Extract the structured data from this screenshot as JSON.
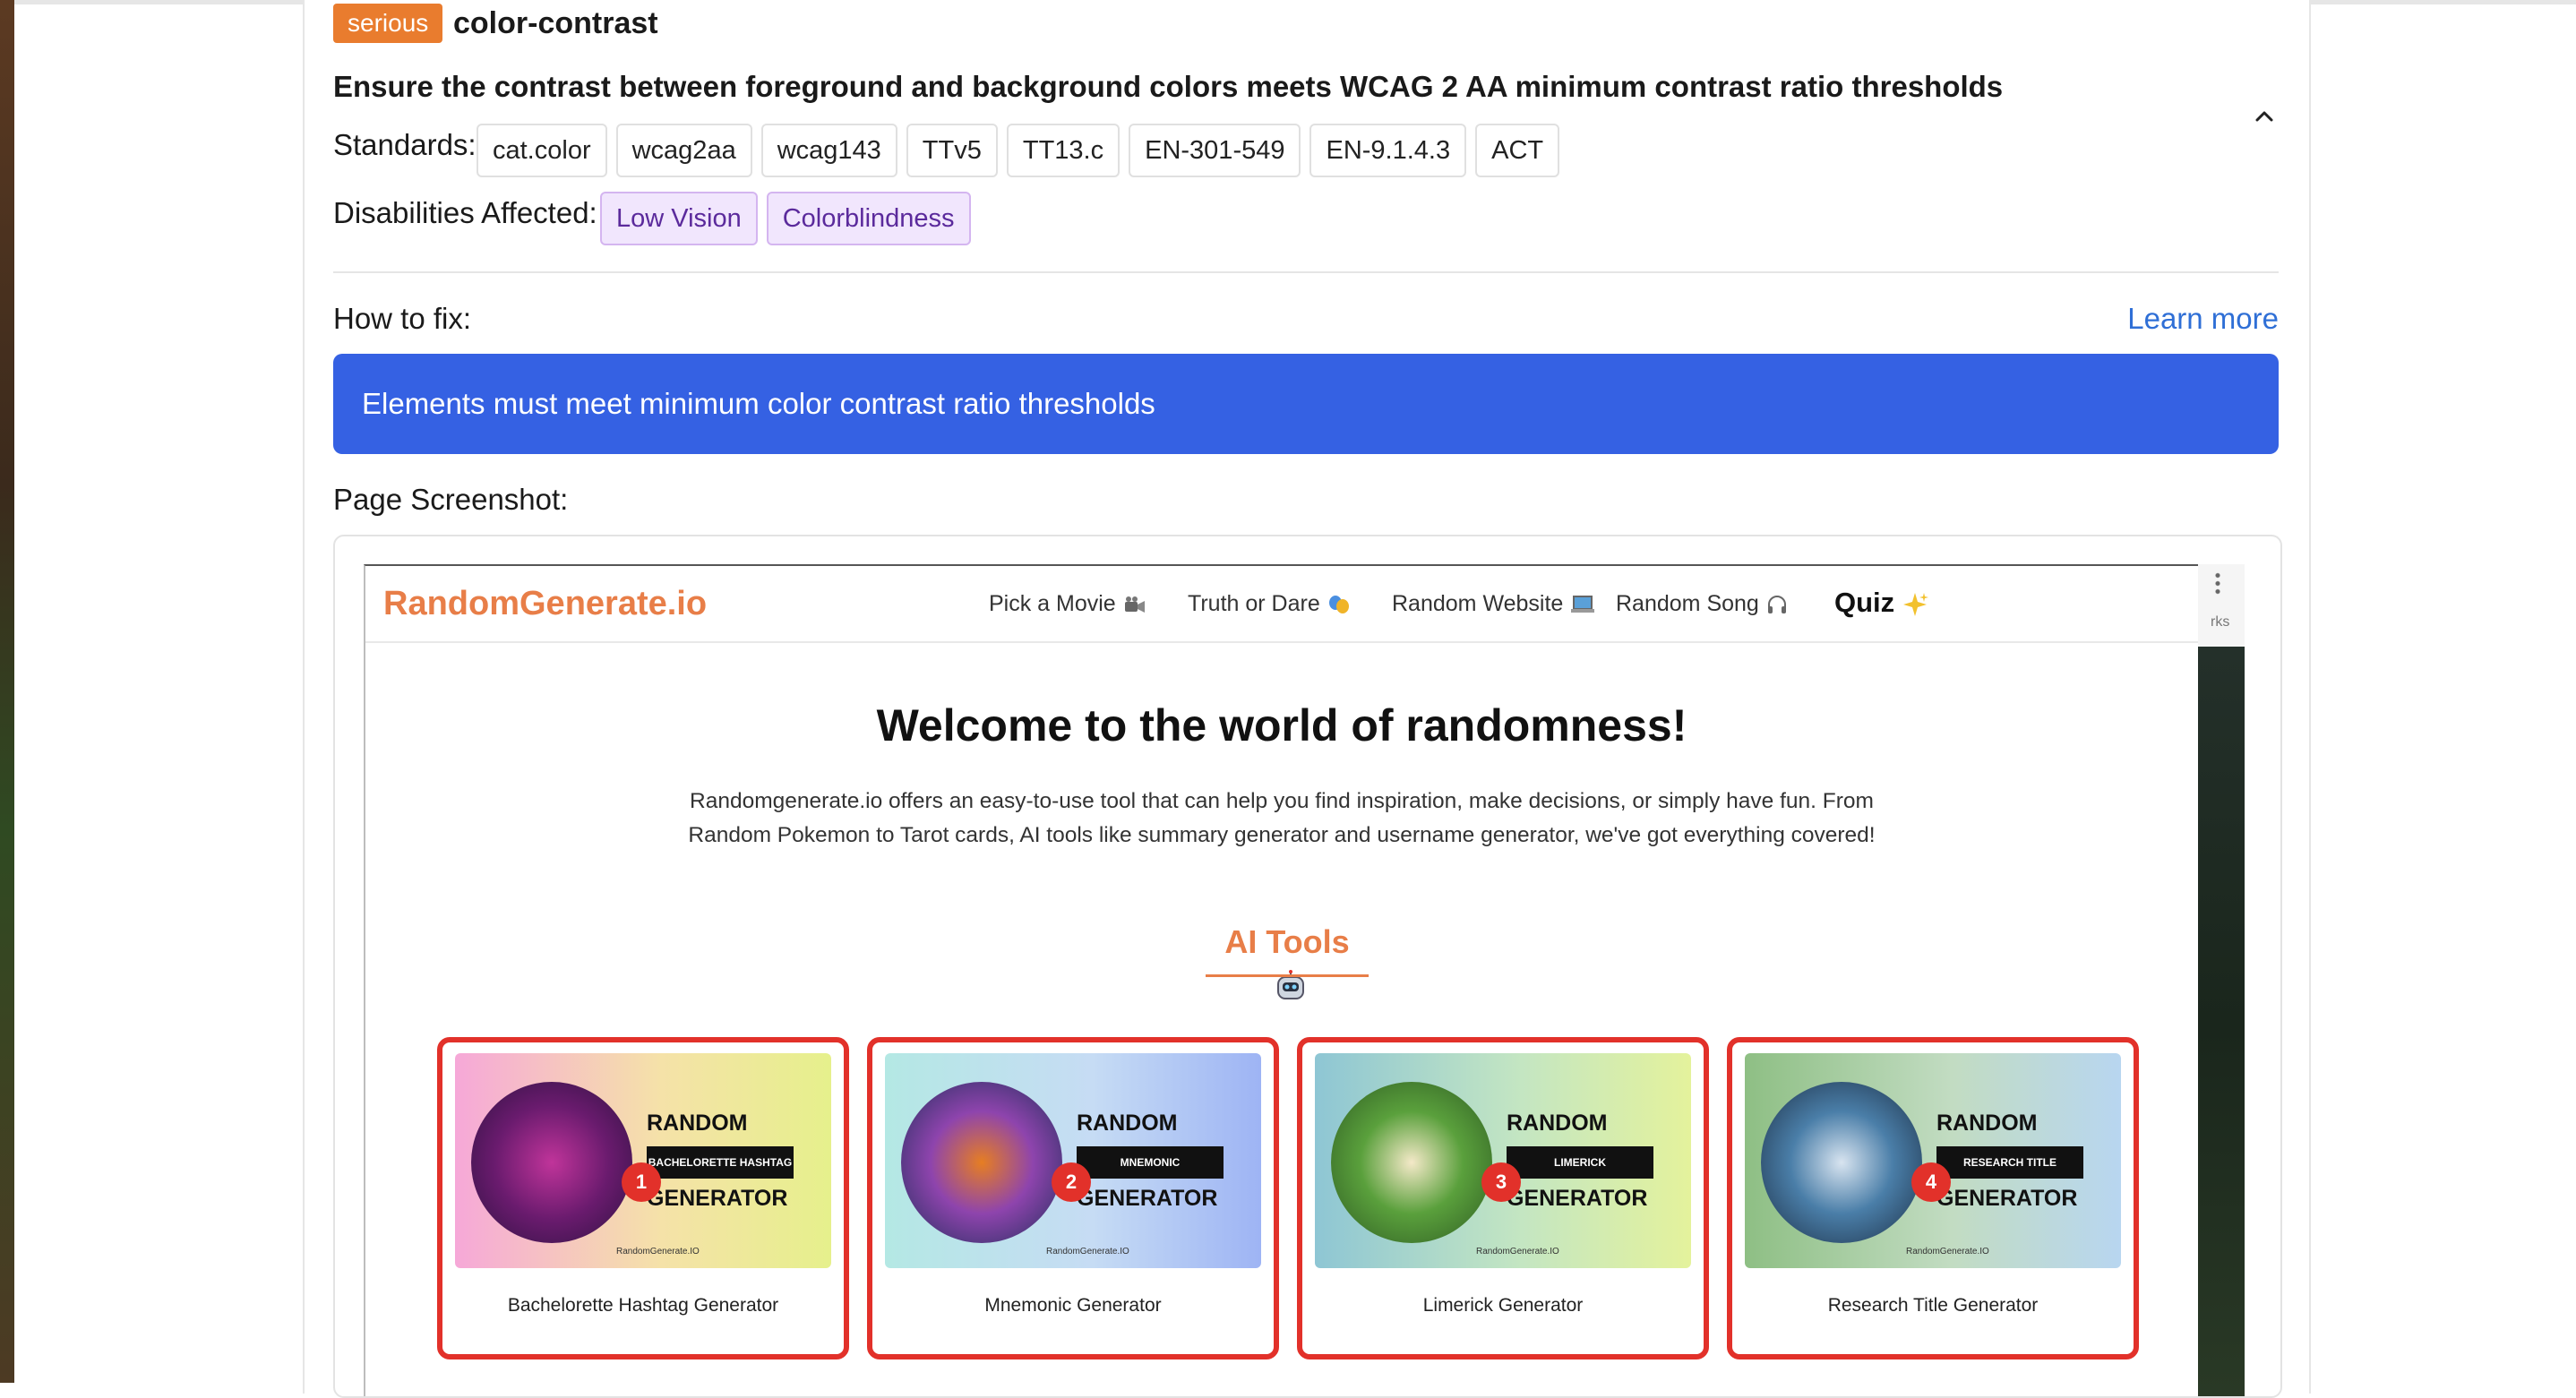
{
  "issue": {
    "impact": "serious",
    "rule_id": "color-contrast",
    "description": "Ensure the contrast between foreground and background colors meets WCAG 2 AA minimum contrast ratio thresholds",
    "standards_label": "Standards:",
    "standards": [
      "cat.color",
      "wcag2aa",
      "wcag143",
      "TTv5",
      "TT13.c",
      "EN-301-549",
      "EN-9.1.4.3",
      "ACT"
    ],
    "disabilities_label": "Disabilities Affected:",
    "disabilities": [
      "Low Vision",
      "Colorblindness"
    ],
    "how_to_fix_label": "How to fix:",
    "learn_more": "Learn more",
    "fix_text": "Elements must meet minimum color contrast ratio thresholds",
    "screenshot_label": "Page Screenshot:"
  },
  "site": {
    "logo": "RandomGenerate.io",
    "nav": [
      "Pick a Movie",
      "Truth or Dare",
      "Random Website",
      "Random Song",
      "Quiz"
    ],
    "heading": "Welcome to the world of randomness!",
    "intro_line1": "Randomgenerate.io offers an easy-to-use tool that can help you find inspiration, make decisions, or simply have fun. From",
    "intro_line2": "Random Pokemon to Tarot cards, AI tools like summary generator and username generator, we've got everything covered!",
    "section_title": "AI Tools",
    "side_text": "rks",
    "cards": [
      {
        "number": "1",
        "title": "Bachelorette Hashtag Generator",
        "thumb_top": "RANDOM",
        "thumb_mid": "BACHELORETTE HASHTAG",
        "thumb_bottom": "GENERATOR",
        "thumb_site": "RandomGenerate.IO"
      },
      {
        "number": "2",
        "title": "Mnemonic Generator",
        "thumb_top": "RANDOM",
        "thumb_mid": "MNEMONIC",
        "thumb_bottom": "GENERATOR",
        "thumb_site": "RandomGenerate.IO"
      },
      {
        "number": "3",
        "title": "Limerick Generator",
        "thumb_top": "RANDOM",
        "thumb_mid": "LIMERICK",
        "thumb_bottom": "GENERATOR",
        "thumb_site": "RandomGenerate.IO"
      },
      {
        "number": "4",
        "title": "Research Title Generator",
        "thumb_top": "RANDOM",
        "thumb_mid": "RESEARCH TITLE",
        "thumb_bottom": "GENERATOR",
        "thumb_site": "RandomGenerate.IO"
      }
    ]
  },
  "colors": {
    "impact_badge": "#e97c2e",
    "fix_banner": "#3561e3",
    "link": "#2f6fd6",
    "highlight_border": "#e2312a",
    "site_accent": "#e87e48",
    "disability_chip": "#f1e6fd"
  },
  "icons": [
    "chevron-up-icon",
    "movie-camera-icon",
    "theater-masks-icon",
    "laptop-icon",
    "headphones-icon",
    "sparkles-icon",
    "robot-icon",
    "kebab-menu-icon"
  ]
}
